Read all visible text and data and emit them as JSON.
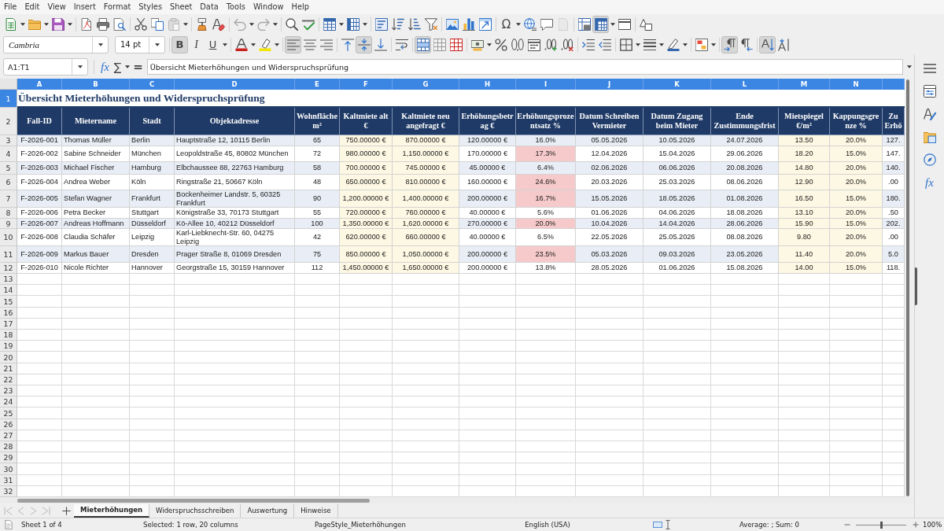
{
  "menu": [
    "File",
    "Edit",
    "View",
    "Insert",
    "Format",
    "Styles",
    "Sheet",
    "Data",
    "Tools",
    "Window",
    "Help"
  ],
  "standard_toolbar": {
    "paste_disabled": true,
    "undo_disabled": true,
    "redo_disabled": true,
    "special_character": "Ω",
    "headers_footers_disabled": true,
    "freeze_selected": true
  },
  "formatting_toolbar": {
    "font_name": "Cambria",
    "font_size": "14 pt",
    "text_style_buttons": [
      {
        "label": "B",
        "selected": true
      },
      {
        "label": "I",
        "selected": false
      },
      {
        "label": "U",
        "selected": false
      }
    ],
    "align_left": true,
    "align_center": false,
    "align_right": false,
    "align_top": false,
    "align_middle": true,
    "align_bottom": false,
    "merge_and_center": true,
    "left_to_right": true,
    "right_to_left": false,
    "stacked_text": true
  },
  "formula_bar": {
    "name_box": "A1:T1",
    "function_wizard": "fx",
    "sum": "∑",
    "formula": "=",
    "content": "Übersicht Mieterhöhungen und Widerspruchsprüfung"
  },
  "sheet": {
    "columns": [
      {
        "label": "A",
        "selected": true
      },
      {
        "label": "B",
        "selected": true
      },
      {
        "label": "C",
        "selected": true
      },
      {
        "label": "D",
        "selected": true
      },
      {
        "label": "E",
        "selected": true
      },
      {
        "label": "F",
        "selected": true
      },
      {
        "label": "G",
        "selected": true
      },
      {
        "label": "H",
        "selected": true
      },
      {
        "label": "I",
        "selected": true
      },
      {
        "label": "J",
        "selected": true
      },
      {
        "label": "K",
        "selected": true
      },
      {
        "label": "L",
        "selected": true
      },
      {
        "label": "M",
        "selected": true
      },
      {
        "label": "N",
        "selected": true
      },
      {
        "selected": true
      }
    ],
    "title_row": {
      "number": "1",
      "selected": true,
      "text": "Übersicht Mieterhöhungen und Widerspruchsprüfung"
    },
    "header_row": {
      "number": "2",
      "selected": false,
      "cells": [
        {
          "text": "Fall-ID",
          "kind": "key"
        },
        {
          "text": "Mietername",
          "kind": "text"
        },
        {
          "text": "Stadt",
          "kind": "text"
        },
        {
          "text": "Objektadresse",
          "kind": "text"
        },
        {
          "text": "Wohnfläche m²",
          "kind": "number"
        },
        {
          "text": "Kaltmiete alt €",
          "kind": "input"
        },
        {
          "text": "Kaltmiete neu angefragt €",
          "kind": "input"
        },
        {
          "text": "Erhöhungsbetrag €",
          "kind": "number"
        },
        {
          "text": "Erhöhungsprozentsatz %",
          "kind": "ratio"
        },
        {
          "text": "Datum Schreiben Vermieter",
          "kind": "number"
        },
        {
          "text": "Datum Zugang beim Mieter",
          "kind": "number"
        },
        {
          "text": "Ende Zustimmungsfrist",
          "kind": "number"
        },
        {
          "text": "Mietspiegel €/m²",
          "kind": "input"
        },
        {
          "text": "Kappungsgrenze %",
          "kind": "input"
        },
        {
          "text": "Zu Erhö",
          "kind": "number"
        }
      ]
    },
    "rows": [
      {
        "number": "3",
        "selected": false,
        "over_limit": false,
        "cells": [
          "F-2026-001",
          "Thomas Müller",
          "Berlin",
          "Hauptstraße 12, 10115 Berlin",
          "65",
          "750.00000 €",
          "870.00000 €",
          "120.00000 €",
          "16.0%",
          "05.05.2026",
          "10.05.2026",
          "24.07.2026",
          "13.50",
          "20.0%",
          "127."
        ]
      },
      {
        "number": "4",
        "selected": false,
        "over_limit": true,
        "cells": [
          "F-2026-002",
          "Sabine Schneider",
          "München",
          "Leopoldstraße 45, 80802 München",
          "72",
          "980.00000 €",
          "1,150.00000 €",
          "170.00000 €",
          "17.3%",
          "12.04.2026",
          "15.04.2026",
          "29.06.2026",
          "18.20",
          "15.0%",
          "147."
        ]
      },
      {
        "number": "5",
        "selected": false,
        "over_limit": false,
        "cells": [
          "F-2026-003",
          "Michael Fischer",
          "Hamburg",
          "Elbchaussee 88, 22763 Hamburg",
          "58",
          "700.00000 €",
          "745.00000 €",
          "45.00000 €",
          "6.4%",
          "02.06.2026",
          "06.06.2026",
          "20.08.2026",
          "14.80",
          "20.0%",
          "140."
        ]
      },
      {
        "number": "6",
        "selected": false,
        "over_limit": true,
        "cells": [
          "F-2026-004",
          "Andrea Weber",
          "Köln",
          "Ringstraße 21, 50667 Köln",
          "48",
          "650.00000 €",
          "810.00000 €",
          "160.00000 €",
          "24.6%",
          "20.03.2026",
          "25.03.2026",
          "08.06.2026",
          "12.90",
          "20.0%",
          ".00"
        ]
      },
      {
        "number": "7",
        "selected": false,
        "over_limit": true,
        "cells": [
          "F-2026-005",
          "Stefan Wagner",
          "Frankfurt",
          "Bockenheimer Landstr. 5, 60325 Frankfurt",
          "90",
          "1,200.00000 €",
          "1,400.00000 €",
          "200.00000 €",
          "16.7%",
          "15.05.2026",
          "18.05.2026",
          "01.08.2026",
          "16.50",
          "15.0%",
          "180."
        ]
      },
      {
        "number": "8",
        "selected": false,
        "over_limit": false,
        "cells": [
          "F-2026-006",
          "Petra Becker",
          "Stuttgart",
          "Königstraße 33, 70173 Stuttgart",
          "55",
          "720.00000 €",
          "760.00000 €",
          "40.00000 €",
          "5.6%",
          "01.06.2026",
          "04.06.2026",
          "18.08.2026",
          "13.10",
          "20.0%",
          ".50"
        ]
      },
      {
        "number": "9",
        "selected": false,
        "over_limit": true,
        "cells": [
          "F-2026-007",
          "Andreas Hoffmann",
          "Düsseldorf",
          "Kö-Allee 10, 40212 Düsseldorf",
          "100",
          "1,350.00000 €",
          "1,620.00000 €",
          "270.00000 €",
          "20.0%",
          "10.04.2026",
          "14.04.2026",
          "28.06.2026",
          "15.90",
          "15.0%",
          "202."
        ]
      },
      {
        "number": "10",
        "selected": false,
        "over_limit": false,
        "cells": [
          "F-2026-008",
          "Claudia Schäfer",
          "Leipzig",
          "Karl-Liebknecht-Str. 60, 04275 Leipzig",
          "42",
          "620.00000 €",
          "660.00000 €",
          "40.00000 €",
          "6.5%",
          "22.05.2026",
          "25.05.2026",
          "08.08.2026",
          "9.80",
          "20.0%",
          ".00"
        ]
      },
      {
        "number": "11",
        "selected": false,
        "over_limit": true,
        "cells": [
          "F-2026-009",
          "Markus Bauer",
          "Dresden",
          "Prager Straße 8, 01069 Dresden",
          "75",
          "850.00000 €",
          "1,050.00000 €",
          "200.00000 €",
          "23.5%",
          "05.03.2026",
          "09.03.2026",
          "23.05.2026",
          "11.40",
          "20.0%",
          "5.0"
        ]
      },
      {
        "number": "12",
        "selected": false,
        "over_limit": false,
        "cells": [
          "F-2026-010",
          "Nicole Richter",
          "Hannover",
          "Georgstraße 15, 30159 Hannover",
          "112",
          "1,450.00000 €",
          "1,650.00000 €",
          "200.00000 €",
          "13.8%",
          "28.05.2026",
          "01.06.2026",
          "15.08.2026",
          "14.00",
          "15.0%",
          "118."
        ]
      }
    ],
    "empty_rows": [
      {
        "number": "13",
        "selected": false
      },
      {
        "number": "14",
        "selected": false
      },
      {
        "number": "15",
        "selected": false
      },
      {
        "number": "16",
        "selected": false
      },
      {
        "number": "17",
        "selected": false
      },
      {
        "number": "18",
        "selected": false
      },
      {
        "number": "19",
        "selected": false
      },
      {
        "number": "20",
        "selected": false
      },
      {
        "number": "21",
        "selected": false
      },
      {
        "number": "22",
        "selected": false
      },
      {
        "number": "23",
        "selected": false
      },
      {
        "number": "24",
        "selected": false
      },
      {
        "number": "25",
        "selected": false
      },
      {
        "number": "26",
        "selected": false
      },
      {
        "number": "27",
        "selected": false
      },
      {
        "number": "28",
        "selected": false
      },
      {
        "number": "29",
        "selected": false
      },
      {
        "number": "30",
        "selected": false
      },
      {
        "number": "31",
        "selected": false
      },
      {
        "number": "32",
        "selected": false
      }
    ]
  },
  "sheet_tabs": [
    {
      "label": "Mieterhöhungen",
      "selected": true
    },
    {
      "label": "Widerspruchsschreiben",
      "selected": false
    },
    {
      "label": "Auswertung",
      "selected": false
    },
    {
      "label": "Hinweise",
      "selected": false
    }
  ],
  "sidebar": {
    "functions": "fx"
  },
  "status_bar": {
    "sheet_position": "Sheet 1 of 4",
    "selection": "Selected: 1 row, 20 columns",
    "page_style": "PageStyle_Mieterhöhungen",
    "language": "English (USA)",
    "summary": "Average: ; Sum: 0",
    "zoom": {
      "level": 0.5,
      "percent": "100%"
    }
  }
}
